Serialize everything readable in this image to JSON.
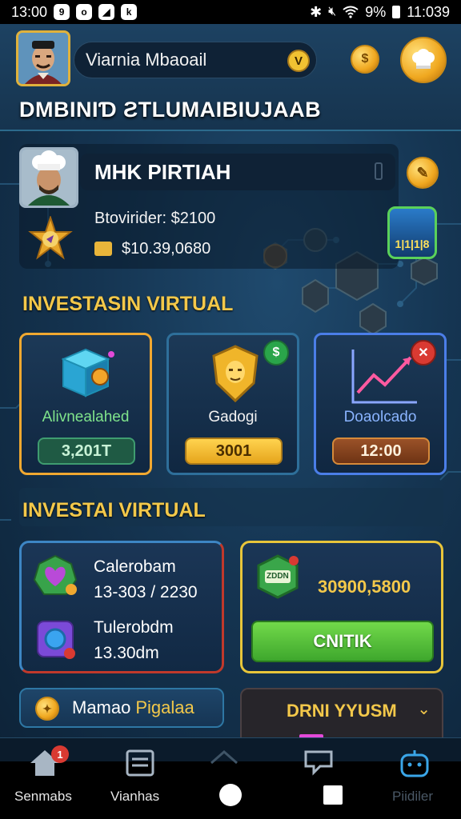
{
  "status_bar": {
    "time": "13:00",
    "battery": "9%",
    "clock_right": "11:039",
    "app_icons": [
      "9",
      "o",
      "◢",
      "k"
    ]
  },
  "header": {
    "user_name": "Viarnia Mbaoail",
    "badge_letter": "V",
    "banner_title": "DMBINIƊ ƧTLUMAIBIUJAAB",
    "icons": [
      "avatar-portrait",
      "gold-coin",
      "chef-hat-coin"
    ]
  },
  "profile": {
    "name": "MHK PIRTIAH",
    "line1": "Btovirider: $2100",
    "line2": "$10.39,0680",
    "level_badge": "1|1|1|8"
  },
  "section1": {
    "title": "INVESTASIN VIRTUAL",
    "cards": [
      {
        "label": "Alivnealahed",
        "button": "3,201T",
        "accent": "#f0a830",
        "btn_color": "#1f5a44",
        "icon": "cube-icon"
      },
      {
        "label": "Gadogi",
        "button": "3001",
        "accent": "#2e6f9a",
        "btn_color": "#f1b62a",
        "icon": "shield-icon",
        "badge": "$"
      },
      {
        "label": "Doaolcado",
        "button": "12:00",
        "accent": "#4b7ee8",
        "btn_color": "#7a3e1c",
        "icon": "chart-up-icon",
        "badge": "✕"
      }
    ]
  },
  "section2": {
    "title": "INVESTAI VIRTUAL",
    "left_panel": {
      "rows": [
        {
          "title": "Calerobam",
          "value": "13-303 / 2230",
          "icon": "heart-gem-icon"
        },
        {
          "title": "Tulerobdm",
          "value": "13.30dm",
          "icon": "ring-gem-icon"
        }
      ]
    },
    "right_panel": {
      "amount": "30900,5800",
      "cta": "CNITIK",
      "icon": "hex-badge-icon",
      "icon_text": "ZDDN"
    }
  },
  "bottom": {
    "promo_text": "Mamao",
    "promo_accent": "Pigalaa",
    "dropdown_text": "DRNI YYUSM"
  },
  "bottom_nav": {
    "items": [
      {
        "label": "Senmabs",
        "icon": "home-icon",
        "notification": "1"
      },
      {
        "label": "Vianhas",
        "icon": "document-icon"
      },
      {
        "label": "",
        "icon": "house-outline-icon"
      },
      {
        "label": "",
        "icon": "card-icon"
      },
      {
        "label": "Piidiler",
        "icon": "bot-icon"
      }
    ]
  },
  "colors": {
    "gold": "#f3c84a",
    "navy": "#0e2238",
    "green_cta": "#4fbf36"
  }
}
